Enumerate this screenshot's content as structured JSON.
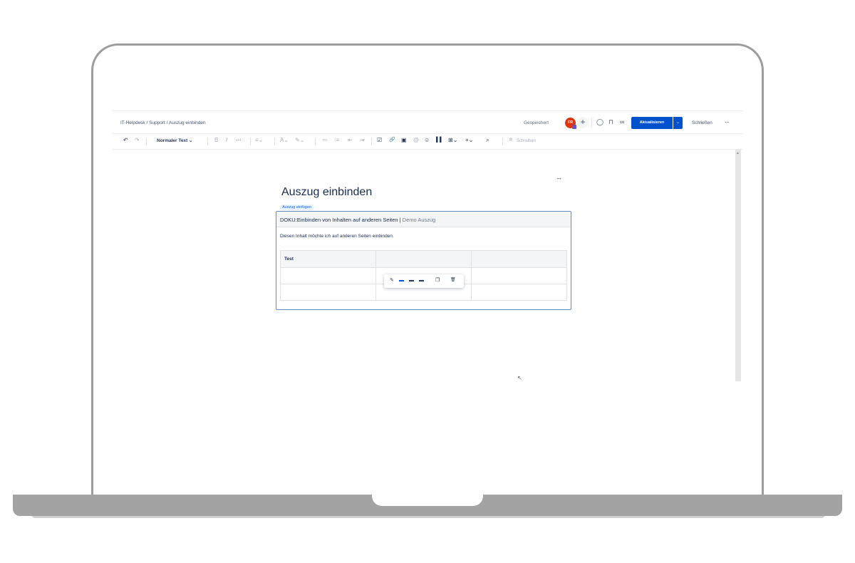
{
  "header": {
    "breadcrumb": "IT-Helpdesk / Support / Auszug einbinden",
    "saved_status": "Gespeichert",
    "avatar_initials": "FR",
    "add_label": "+",
    "update_label": "Aktualisieren",
    "update_dropdown": "⌄",
    "close_label": "Schließen",
    "more_label": "···"
  },
  "toolbar": {
    "undo": "↶",
    "redo": "↷",
    "text_style": "Normaler Text ⌄",
    "bold": "B",
    "italic": "I",
    "more_format": "···",
    "align": "≡⌄",
    "text_color": "A⌄",
    "highlight": "✎⌄",
    "bullet_list": "≔",
    "numbered_list": "⁝≡",
    "outdent": "⇤",
    "indent": "⇥",
    "task": "☑",
    "link": "🔗",
    "image": "▣",
    "mention": "@",
    "emoji": "☺",
    "layout": "▌▌",
    "table": "⊞⌄",
    "insert": "+⌄",
    "find": "⌕",
    "write_label": "Schreiben"
  },
  "editor": {
    "width_toggle": "↔",
    "page_title": "Auszug einbinden",
    "macro_label": "Auszug einfügen",
    "macro_header_main": "DOKU:Einbinden von Inhalten auf anderen Seiten | ",
    "macro_header_sub": "Demo Auszug",
    "macro_body": "Diesen Inhalt möchte ich auf anderen Seiten einbinden.",
    "table": {
      "header": [
        "Test",
        "",
        ""
      ],
      "rows": [
        [
          "",
          "",
          ""
        ],
        [
          "",
          "",
          ""
        ]
      ]
    },
    "float_toolbar": {
      "edit": "✎",
      "layout_a": "▬",
      "layout_b": "▬",
      "layout_c": "▬",
      "copy": "❐",
      "delete": "🗑"
    }
  },
  "colors": {
    "primary": "#0052cc",
    "avatar": "#de350b",
    "text": "#172b4d",
    "subtle": "#6b778c"
  }
}
